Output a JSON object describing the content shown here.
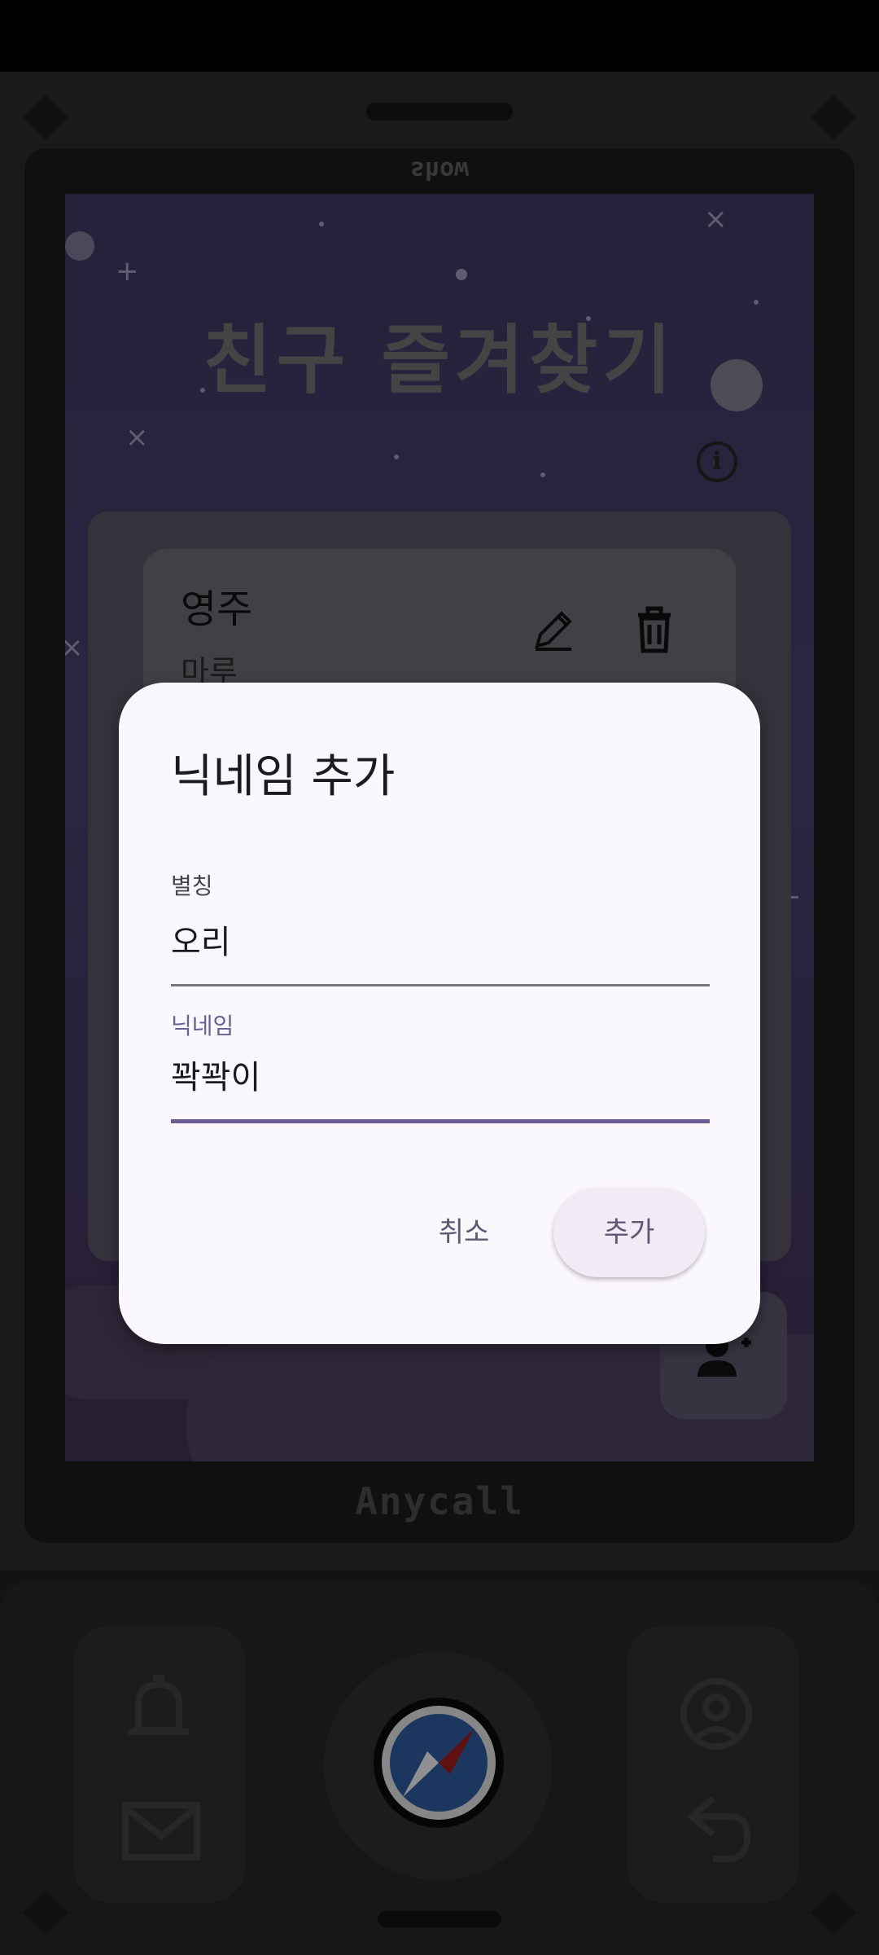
{
  "device": {
    "brand_top": "show",
    "brand_bottom": "Anycall"
  },
  "app": {
    "title": "친구 즐겨찾기",
    "info_icon": "info-icon"
  },
  "friend_card": {
    "name": "영주",
    "sub": "마루",
    "edit_icon": "pencil-icon",
    "delete_icon": "trash-icon"
  },
  "fab": {
    "icon": "person-add-icon"
  },
  "dialog": {
    "title": "닉네임 추가",
    "alias_label": "별칭",
    "alias_value": "오리",
    "nickname_label": "닉네임",
    "nickname_value": "꽉꽉이",
    "cancel_label": "취소",
    "add_label": "추가"
  },
  "keypad": {
    "left_top_icon": "bell-icon",
    "left_bottom_icon": "mail-icon",
    "center_icon": "compass-icon",
    "right_top_icon": "person-circle-icon",
    "right_bottom_icon": "back-arrow-icon"
  },
  "colors": {
    "dialog_bg": "#fbf7fe",
    "accent": "#6b5c98",
    "screen_bg": "#453d6a"
  }
}
